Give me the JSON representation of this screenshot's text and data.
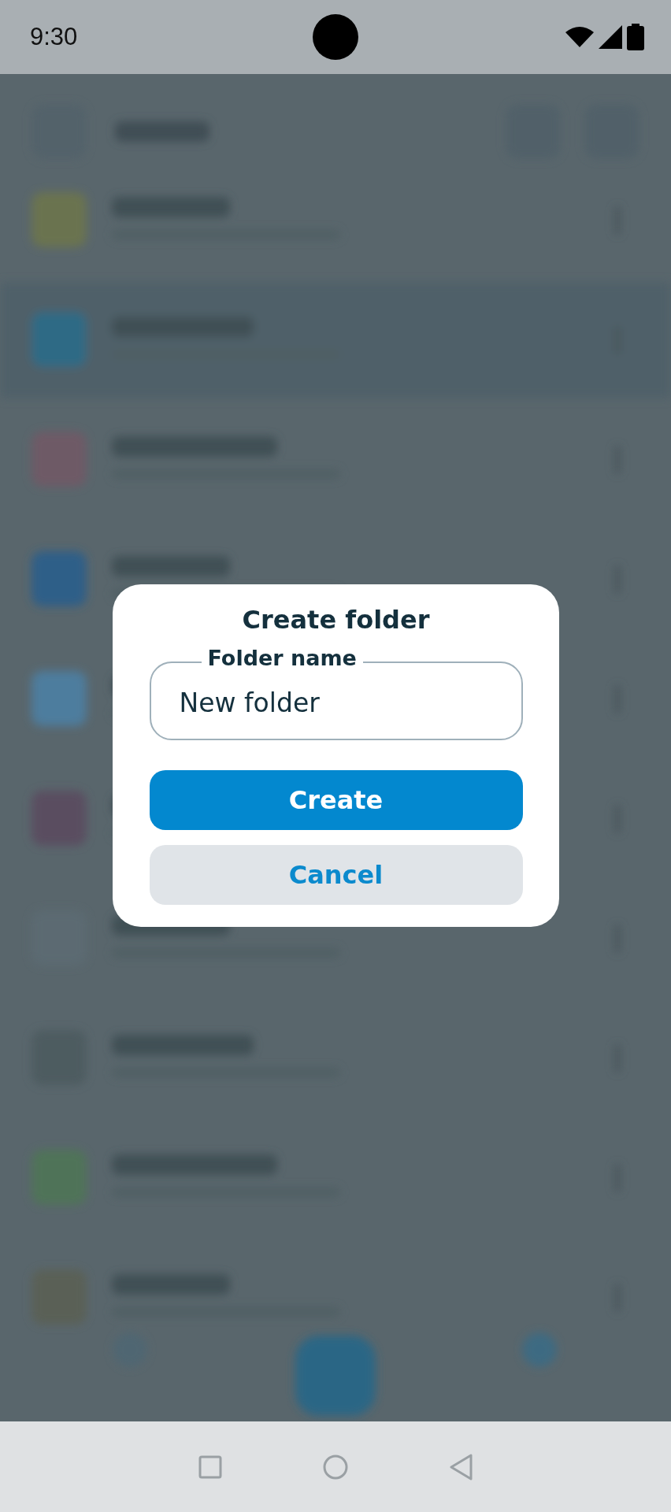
{
  "status_bar": {
    "time": "9:30"
  },
  "dialog": {
    "title": "Create folder",
    "field": {
      "label": "Folder name",
      "value": "New folder"
    },
    "buttons": [
      {
        "label": "Create",
        "kind": "primary"
      },
      {
        "label": "Cancel",
        "kind": "secondary"
      }
    ]
  }
}
